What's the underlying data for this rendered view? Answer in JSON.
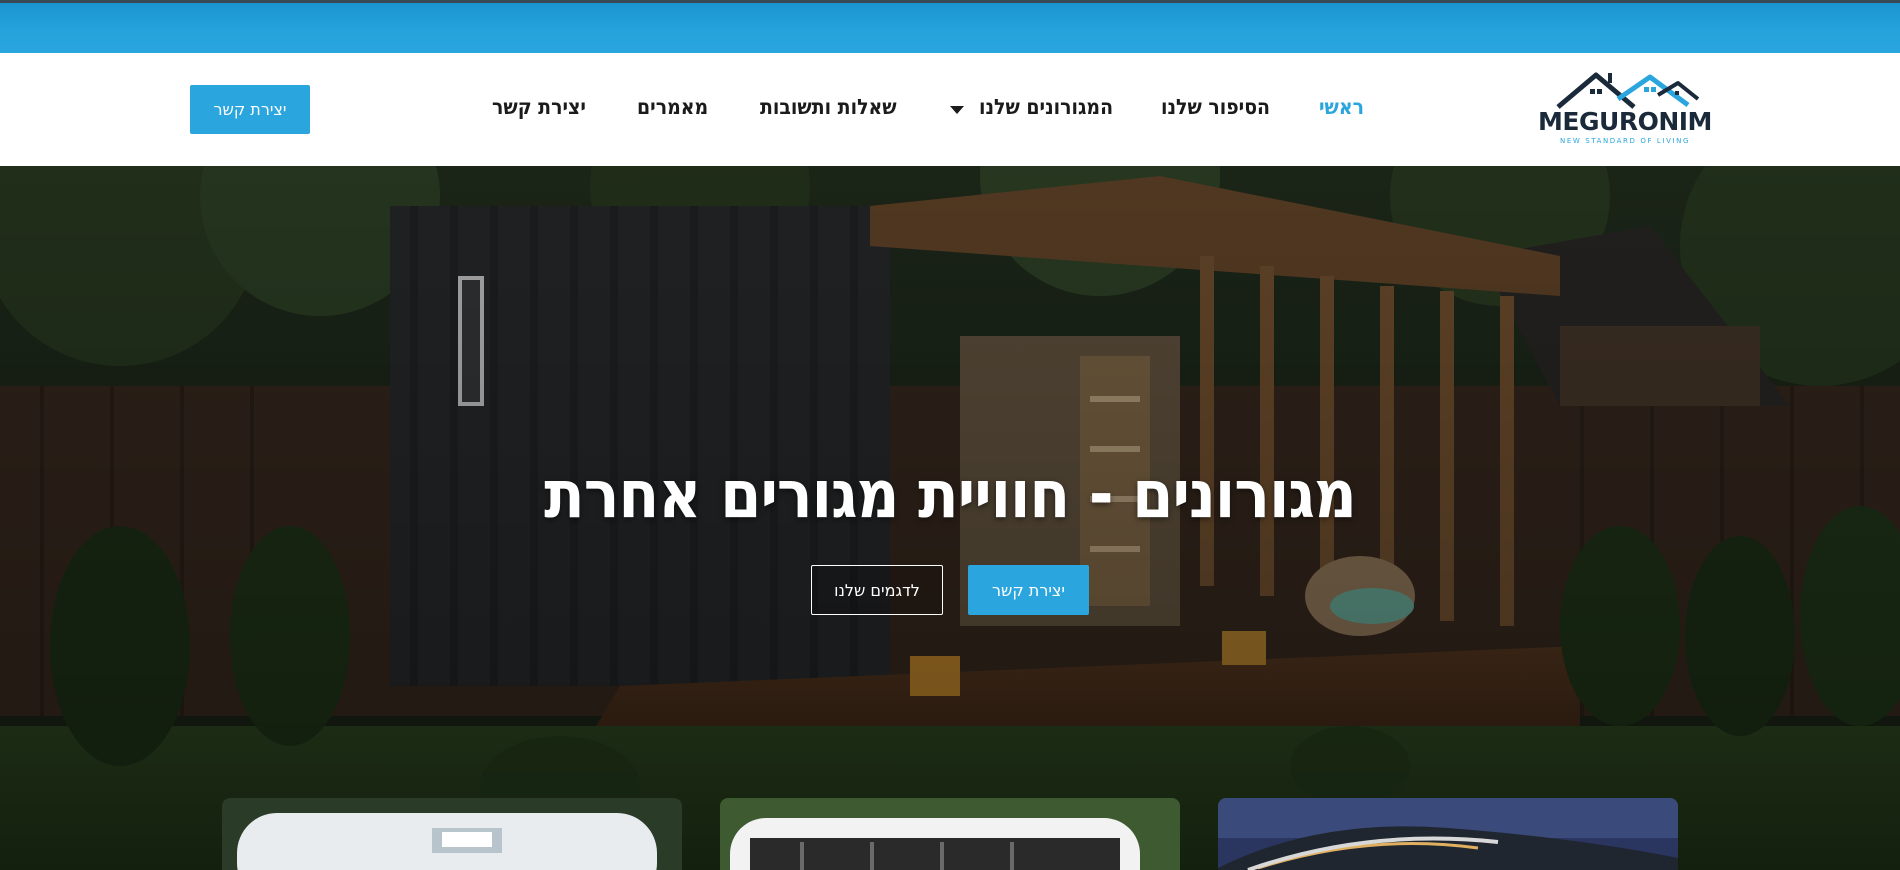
{
  "brand": {
    "logo_name": "MEGURONIM",
    "tagline": "NEW STANDARD OF LIVING",
    "accent_color": "#2aa5de"
  },
  "nav": {
    "home": "ראשי",
    "story": "הסיפור שלנו",
    "homes": "המגורונים שלנו",
    "faq": "שאלות ותשובות",
    "articles": "מאמרים",
    "contact": "יצירת קשר"
  },
  "header_button": "יצירת קשר",
  "hero": {
    "title": "מגורונים - חוויית מגורים אחרת",
    "primary_button": "יצירת קשר",
    "secondary_button": "לדגמים שלנו"
  }
}
